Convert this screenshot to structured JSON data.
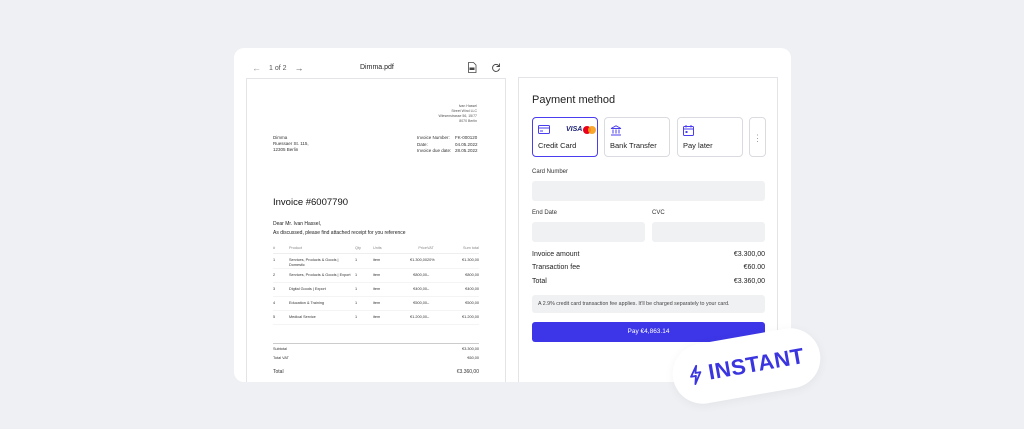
{
  "toolbar": {
    "page_indicator": "1 of 2",
    "filename": "Dimma.pdf"
  },
  "pdf": {
    "sender": [
      "Ivan Hassel",
      "Street Wind LLC",
      "Wiesenstrasse 56, 15/77",
      "8070 Berlin"
    ],
    "recipient": [
      "Dimma",
      "Ruessaer St. 115,",
      "12305 Berlin"
    ],
    "meta": [
      {
        "key": "Invoice Number:",
        "value": "FK-000120"
      },
      {
        "key": "Date:",
        "value": "04.05.2022"
      },
      {
        "key": "Invoice due date:",
        "value": "28.05.2022"
      }
    ],
    "title": "Invoice #6007790",
    "greeting": "Dear Mr. Ivan Hassel,",
    "message": "As discussed, please find attached receipt for you reference",
    "columns": [
      "#",
      "Product",
      "Qty",
      "Units",
      "Price",
      "VAT",
      "Sum total"
    ],
    "rows": [
      [
        "1",
        "Services, Products & Goods | Domestic",
        "1",
        "item",
        "€1.300,00",
        "20%",
        "€1.300,00"
      ],
      [
        "2",
        "Services, Products & Goods | Export",
        "1",
        "item",
        "€800,00",
        "–",
        "€800,00"
      ],
      [
        "3",
        "Digital Goods | Export",
        "1",
        "item",
        "€400,00",
        "–",
        "€400,00"
      ],
      [
        "4",
        "Education & Training",
        "1",
        "item",
        "€500,00",
        "–",
        "€500,00"
      ],
      [
        "5",
        "Medical Service",
        "1",
        "item",
        "€1.200,00",
        "–",
        "€1.200,00"
      ]
    ],
    "subtotal_label": "Subtotal",
    "subtotal": "€3.300,00",
    "vat_label": "Total VAT",
    "vat": "€60,00",
    "total_label": "Total",
    "total": "€3.360,00"
  },
  "payment": {
    "heading": "Payment method",
    "methods": [
      {
        "label": "Credit Card",
        "icon": "credit-card-icon",
        "selected": true
      },
      {
        "label": "Bank Transfer",
        "icon": "bank-icon",
        "selected": false
      },
      {
        "label": "Pay later",
        "icon": "calendar-icon",
        "selected": false
      }
    ],
    "visa_label": "VISA",
    "card_number_label": "Card Number",
    "end_date_label": "End Date",
    "cvc_label": "CVC",
    "invoice_amount_label": "Invoice amount",
    "invoice_amount": "€3.300,00",
    "fee_label": "Transaction fee",
    "fee": "€60.00",
    "total_label": "Total",
    "total": "€3.360,00",
    "note": "A 2.9% credit card transaction fee applies. It'll be charged separately to your card.",
    "pay_button": "Pay €4,863.14"
  },
  "badge": {
    "label": "INSTANT",
    "icon": "lightning-icon"
  },
  "colors": {
    "accent": "#3d36e8",
    "background": "#eef0f4"
  }
}
